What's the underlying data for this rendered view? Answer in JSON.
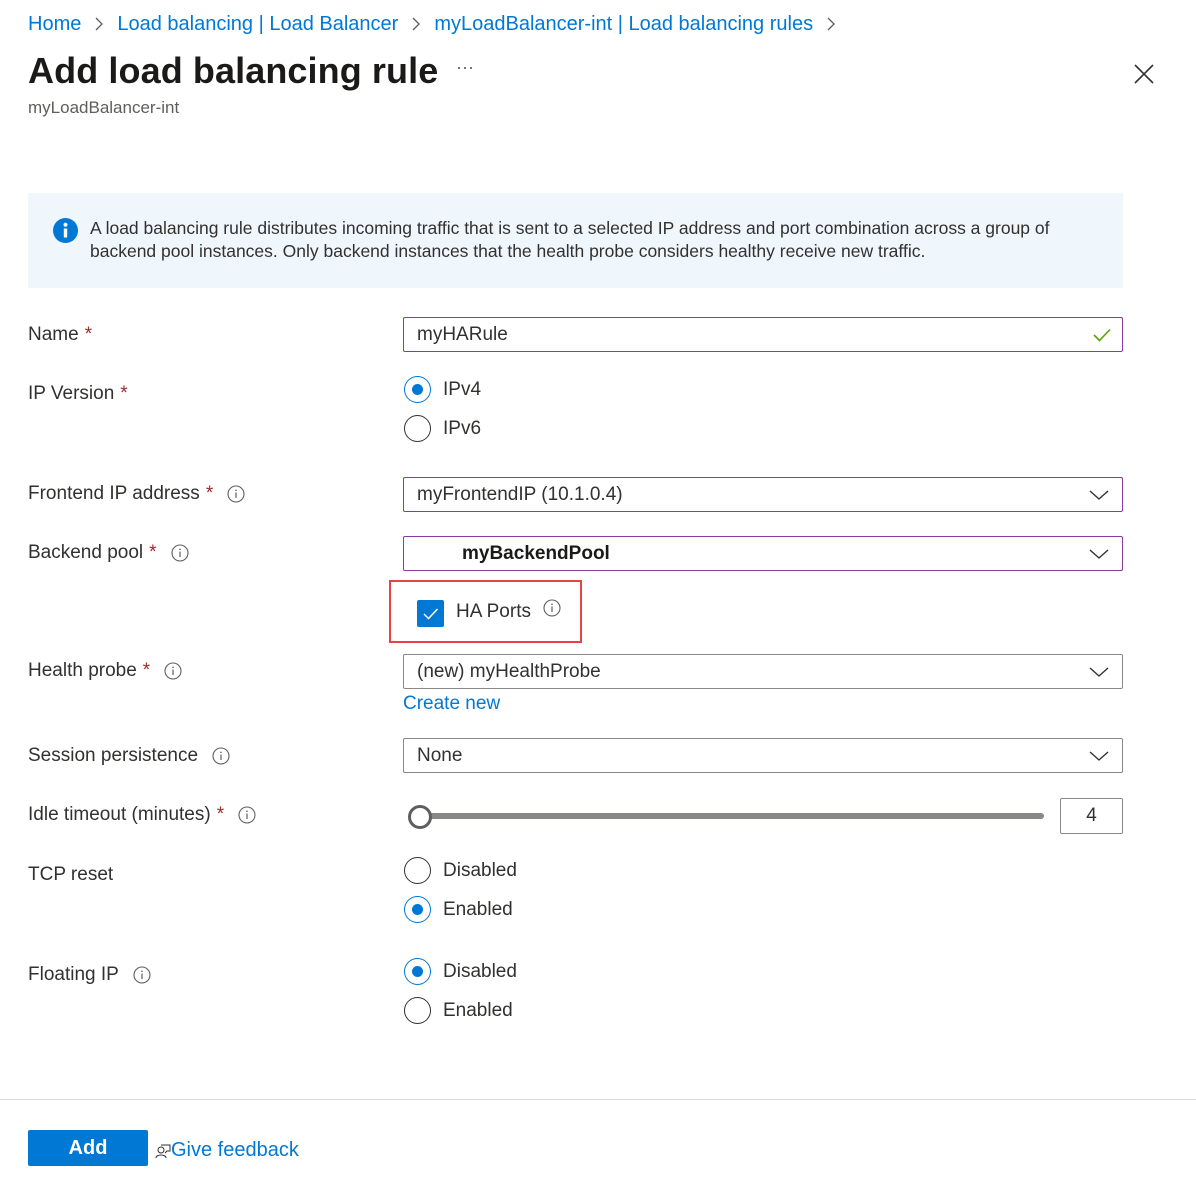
{
  "breadcrumb": [
    {
      "label": "Home"
    },
    {
      "label": "Load balancing | Load Balancer"
    },
    {
      "label": "myLoadBalancer-int | Load balancing rules"
    }
  ],
  "header": {
    "title": "Add load balancing rule",
    "subtitle": "myLoadBalancer-int",
    "more_label": "···",
    "close_icon": "close-icon"
  },
  "info_banner": {
    "icon": "info-icon",
    "text": "A load balancing rule distributes incoming traffic that is sent to a selected IP address and port combination across a group of backend pool instances. Only backend instances that the health probe considers healthy receive new traffic."
  },
  "form": {
    "required_mark": "*",
    "name": {
      "label": "Name",
      "value": "myHARule",
      "valid": true
    },
    "ip_version": {
      "label": "IP Version",
      "options": [
        {
          "label": "IPv4",
          "checked": true
        },
        {
          "label": "IPv6",
          "checked": false
        }
      ]
    },
    "frontend_ip": {
      "label": "Frontend IP address",
      "value": "myFrontendIP (10.1.0.4)"
    },
    "backend_pool": {
      "label": "Backend pool",
      "value": "myBackendPool"
    },
    "ha_ports": {
      "label": "HA Ports",
      "checked": true
    },
    "health_probe": {
      "label": "Health probe",
      "value": "(new) myHealthProbe",
      "create_new": "Create new"
    },
    "session_persistence": {
      "label": "Session persistence",
      "value": "None"
    },
    "idle_timeout": {
      "label": "Idle timeout (minutes)",
      "value": "4",
      "min": 4,
      "max": 30
    },
    "tcp_reset": {
      "label": "TCP reset",
      "options": [
        {
          "label": "Disabled",
          "checked": false
        },
        {
          "label": "Enabled",
          "checked": true
        }
      ]
    },
    "floating_ip": {
      "label": "Floating IP",
      "options": [
        {
          "label": "Disabled",
          "checked": true
        },
        {
          "label": "Enabled",
          "checked": false
        }
      ]
    }
  },
  "footer": {
    "add_label": "Add",
    "feedback_label": "Give feedback"
  },
  "colors": {
    "accent": "#0078d4",
    "required": "#a4262c",
    "highlight": "#ea4242",
    "banner_bg": "#eff6fc",
    "focus_border": "#8a3aa0",
    "valid_check": "#57a300"
  }
}
